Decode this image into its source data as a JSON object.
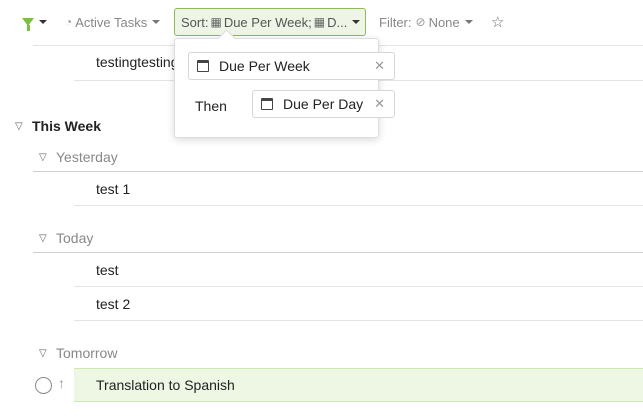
{
  "toolbar": {
    "active_label": "Active Tasks",
    "sort_prefix": "Sort:",
    "sort_first": "Due Per Week;",
    "sort_second": "D...",
    "filter_prefix": "Filter:",
    "filter_value": "None"
  },
  "list": {
    "overflow_row": "testingtesting",
    "section": "This Week",
    "groups": [
      {
        "title": "Yesterday",
        "items": [
          "test 1"
        ]
      },
      {
        "title": "Today",
        "items": [
          "test",
          "test 2"
        ]
      },
      {
        "title": "Tomorrow",
        "items": [
          "Translation to Spanish"
        ]
      }
    ]
  },
  "sort_popover": {
    "first": "Due Per Week",
    "then_label": "Then",
    "second": "Due Per Day"
  },
  "icons": {
    "filter": "funnel-icon",
    "active": "half-circle-icon",
    "calendar": "calendar-icon",
    "none": "circle-slash-icon",
    "star": "star-icon",
    "remove": "close-icon",
    "expand": "chevron-down-icon",
    "complete": "circle-icon",
    "priority": "arrow-up-icon"
  },
  "colors": {
    "accent": "#7cbf3a",
    "sort_bg": "#eef5e6",
    "highlight_bg": "#eef6e4"
  }
}
